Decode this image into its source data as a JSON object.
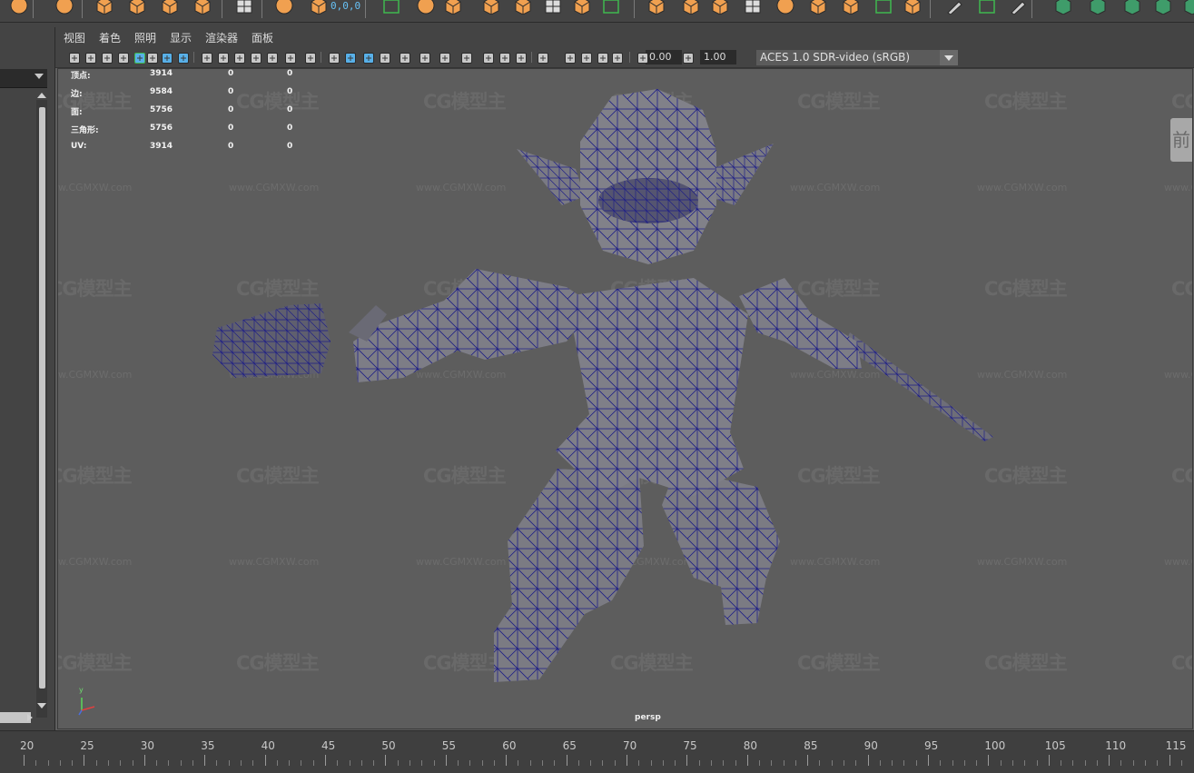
{
  "panel_menu": [
    "视图",
    "着色",
    "照明",
    "显示",
    "渲染器",
    "面板"
  ],
  "shelf": {
    "coord_readout": "0,0,0"
  },
  "viewport_toolbar": {
    "exposure_value": "0.00",
    "gamma_value": "1.00",
    "color_space": "ACES 1.0 SDR-video (sRGB)"
  },
  "hud": {
    "rows": [
      {
        "label": "顶点:",
        "v1": "3914",
        "v2": "0",
        "v3": "0"
      },
      {
        "label": "边:",
        "v1": "9584",
        "v2": "0",
        "v3": "0"
      },
      {
        "label": "面:",
        "v1": "5756",
        "v2": "0",
        "v3": "0"
      },
      {
        "label": "三角形:",
        "v1": "5756",
        "v2": "0",
        "v3": "0"
      },
      {
        "label": "UV:",
        "v1": "3914",
        "v2": "0",
        "v3": "0"
      }
    ]
  },
  "camera_name": "persp",
  "axis_label": "y",
  "view_cube_label": "前",
  "watermark": {
    "logo": "CG模型主",
    "url": "www.CGMXW.com"
  },
  "timeline": {
    "ticks": [
      "20",
      "25",
      "30",
      "35",
      "40",
      "45",
      "50",
      "55",
      "60",
      "65",
      "70",
      "75",
      "80",
      "85",
      "90",
      "95",
      "100",
      "105",
      "110",
      "115"
    ]
  },
  "colors": {
    "ui_background": "#444444",
    "viewport_background": "#5d5d5d",
    "wireframe": "#1a1a80",
    "shelf_accent": "#f0a050",
    "highlight_green": "#3fb84e",
    "highlight_blue": "#58b0e8"
  }
}
